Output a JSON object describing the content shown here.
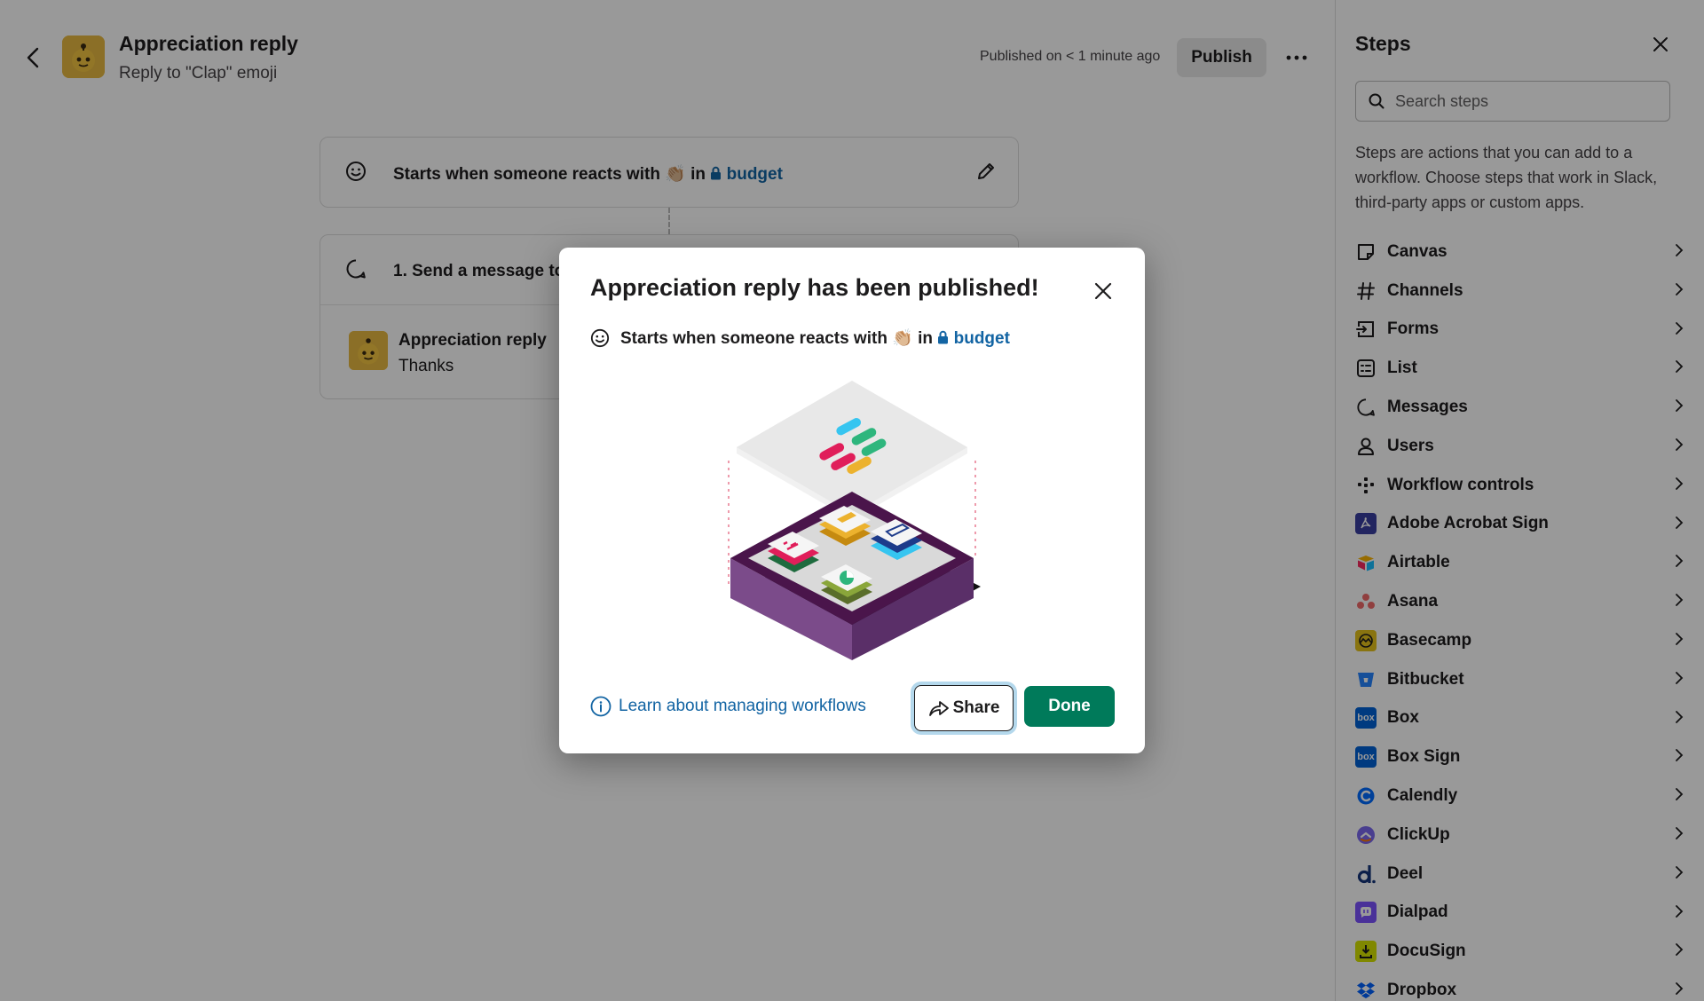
{
  "header": {
    "title": "Appreciation reply",
    "subtitle": "Reply to \"Clap\" emoji",
    "published_status": "Published on < 1 minute ago",
    "publish_label": "Publish"
  },
  "trigger": {
    "prefix": "Starts when someone reacts with",
    "emoji": "👏🏼",
    "in_word": "in",
    "channel": "budget"
  },
  "step": {
    "title": "1. Send a message to",
    "sender": "Appreciation reply",
    "message": "Thanks"
  },
  "modal": {
    "title": "Appreciation reply has been published!",
    "learn_link": "Learn about managing workflows",
    "share_label": "Share",
    "done_label": "Done"
  },
  "sidebar": {
    "title": "Steps",
    "search_placeholder": "Search steps",
    "description": "Steps are actions that you can add to a workflow. Choose steps that work in Slack, third-party apps or custom apps.",
    "items": [
      {
        "label": "Canvas",
        "icon": "canvas-icon"
      },
      {
        "label": "Channels",
        "icon": "hash-icon"
      },
      {
        "label": "Forms",
        "icon": "form-icon"
      },
      {
        "label": "List",
        "icon": "list-icon"
      },
      {
        "label": "Messages",
        "icon": "message-icon"
      },
      {
        "label": "Users",
        "icon": "user-icon"
      },
      {
        "label": "Workflow controls",
        "icon": "workflow-icon"
      },
      {
        "label": "Adobe Acrobat Sign",
        "icon": "adobe-acrobat-sign-icon",
        "color": "#3a3fa0"
      },
      {
        "label": "Airtable",
        "icon": "airtable-icon",
        "color": "#f82b60"
      },
      {
        "label": "Asana",
        "icon": "asana-icon",
        "color": "#f06a6a"
      },
      {
        "label": "Basecamp",
        "icon": "basecamp-icon",
        "color": "#e5c21c"
      },
      {
        "label": "Bitbucket",
        "icon": "bitbucket-icon",
        "color": "#2684ff"
      },
      {
        "label": "Box",
        "icon": "box-icon",
        "color": "#0061d5"
      },
      {
        "label": "Box Sign",
        "icon": "box-sign-icon",
        "color": "#0061d5"
      },
      {
        "label": "Calendly",
        "icon": "calendly-icon",
        "color": "#006bff"
      },
      {
        "label": "ClickUp",
        "icon": "clickup-icon",
        "color": "#7b68ee"
      },
      {
        "label": "Deel",
        "icon": "deel-icon",
        "color": "#15357a"
      },
      {
        "label": "Dialpad",
        "icon": "dialpad-icon",
        "color": "#7c52ff"
      },
      {
        "label": "DocuSign",
        "icon": "docusign-icon",
        "color": "#d5e300"
      },
      {
        "label": "Dropbox",
        "icon": "dropbox-icon",
        "color": "#0061fe"
      }
    ]
  },
  "colors": {
    "link": "#1264a3",
    "done_green": "#007a5a",
    "focus_ring": "#b4d8ec"
  }
}
